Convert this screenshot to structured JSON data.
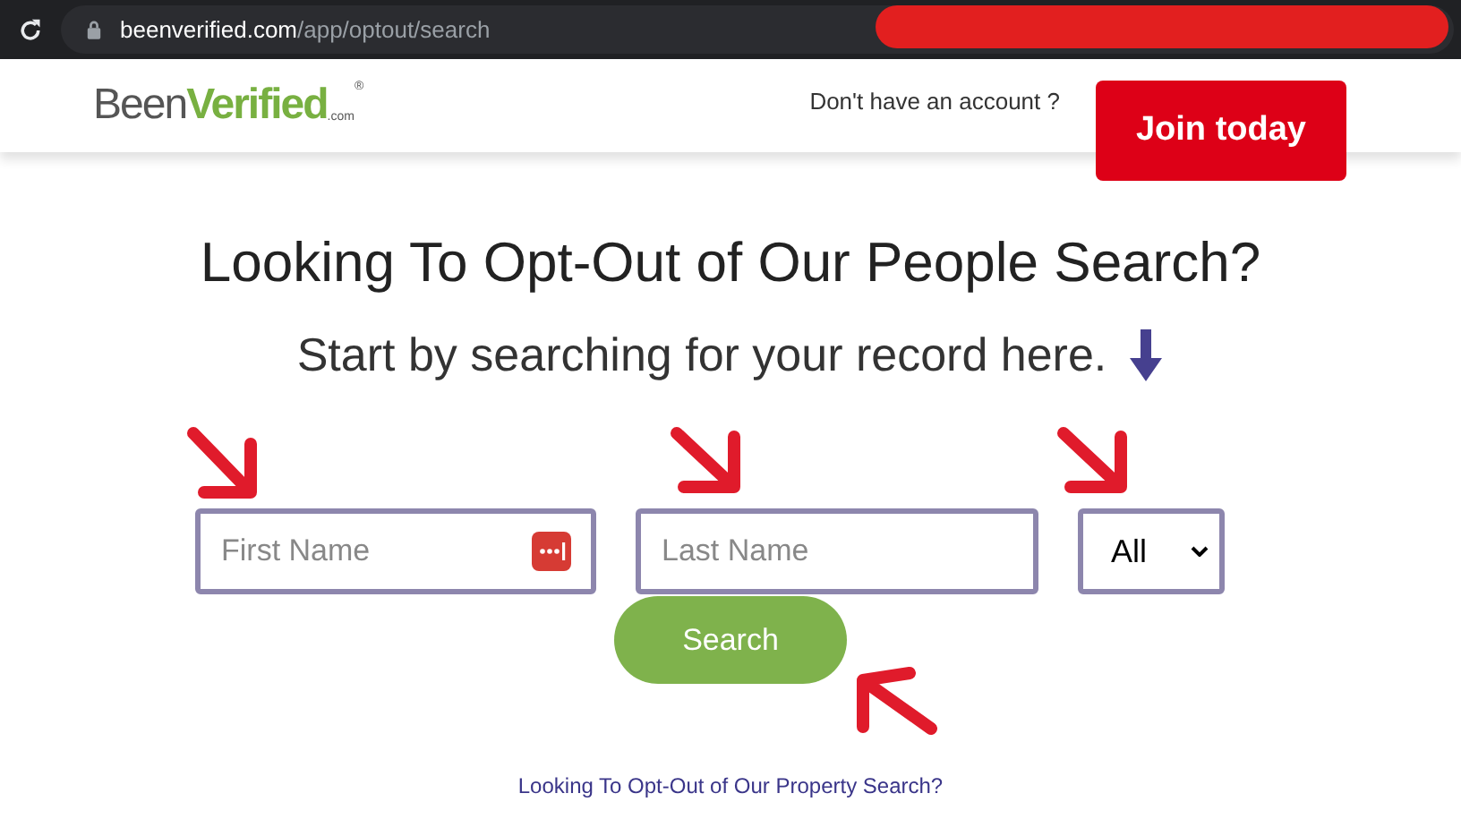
{
  "browser": {
    "url_host": "beenverified.com",
    "url_path": "/app/optout/search"
  },
  "header": {
    "logo": {
      "been": "Been",
      "verified": "Verified",
      "com": ".com",
      "mark": "®"
    },
    "account_prompt": "Don't have an account ?",
    "join_button": "Join today"
  },
  "main": {
    "title": "Looking To Opt-Out of Our People Search?",
    "subtitle": "Start by searching for your record here.",
    "fields": [
      {
        "placeholder": "First Name",
        "kind": "password-manager"
      },
      {
        "placeholder": "Last Name",
        "kind": "plain"
      }
    ],
    "state_select": {
      "value": "All"
    },
    "search_button": "Search",
    "property_link": "Looking To Opt-Out of Our Property Search?"
  }
}
